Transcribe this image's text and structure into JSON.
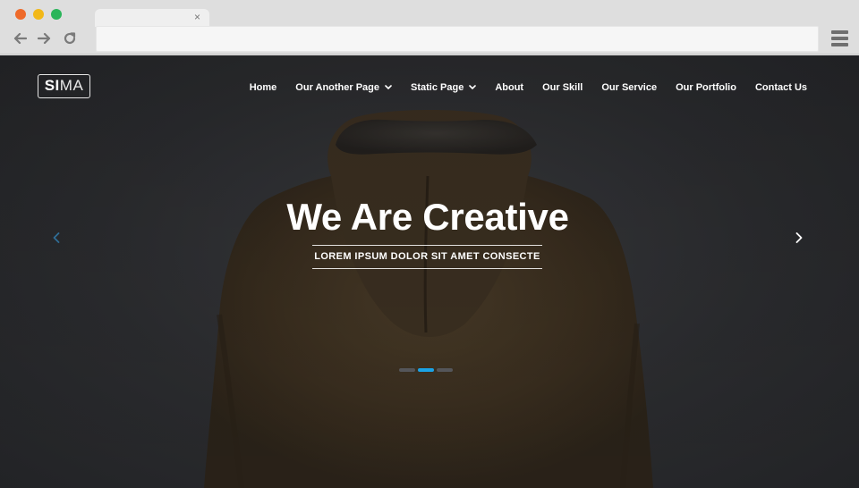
{
  "browser": {
    "traffic_lights": [
      "#ee6a2a",
      "#f2b818",
      "#2ab55a"
    ],
    "tab_close_label": "×",
    "url": "",
    "icons": [
      "back-arrow-icon",
      "forward-arrow-icon",
      "reload-icon",
      "hamburger-menu-icon"
    ]
  },
  "site": {
    "logo": {
      "bold": "SI",
      "light": "MA"
    },
    "nav": [
      {
        "label": "Home",
        "dropdown": false
      },
      {
        "label": "Our Another Page",
        "dropdown": true
      },
      {
        "label": "Static Page",
        "dropdown": true
      },
      {
        "label": "About",
        "dropdown": false
      },
      {
        "label": "Our Skill",
        "dropdown": false
      },
      {
        "label": "Our Service",
        "dropdown": false
      },
      {
        "label": "Our Portfolio",
        "dropdown": false
      },
      {
        "label": "Contact Us",
        "dropdown": false
      }
    ],
    "hero": {
      "title": "We Are Creative",
      "subtitle": "LOREM IPSUM DOLOR SIT AMET CONSECTE"
    },
    "carousel": {
      "slide_count": 3,
      "active_index": 1,
      "accent_color": "#1aa3e6"
    }
  }
}
